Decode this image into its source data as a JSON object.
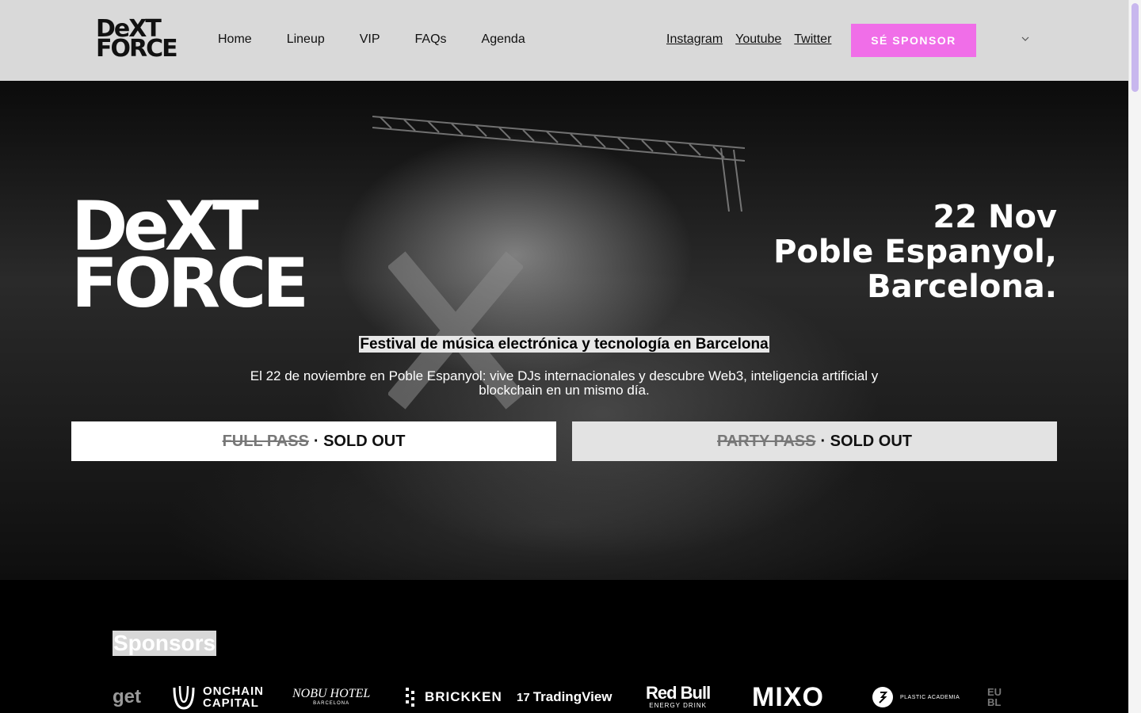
{
  "brand": {
    "logo_line1": "DeXT",
    "logo_line2": "FORCE"
  },
  "nav": {
    "items": [
      {
        "label": "Home"
      },
      {
        "label": "Lineup"
      },
      {
        "label": "VIP"
      },
      {
        "label": "FAQs"
      },
      {
        "label": "Agenda"
      }
    ]
  },
  "social": {
    "items": [
      {
        "label": "Instagram"
      },
      {
        "label": "Youtube"
      },
      {
        "label": "Twitter"
      }
    ]
  },
  "header": {
    "sponsor_button": "SÉ SPONSOR",
    "lang_icon": "chevron-down-icon"
  },
  "hero": {
    "date": "22 Nov",
    "venue_line1": "Poble Espanyol,",
    "venue_line2": "Barcelona.",
    "tagline": "Festival de música electrónica y tecnología en Barcelona",
    "description": "El 22 de noviembre en Poble Espanyol: vive DJs internacionales y descubre Web3, inteligencia artificial y blockchain en un mismo día.",
    "passes": [
      {
        "name": "FULL PASS",
        "status": "· SOLD OUT"
      },
      {
        "name": "PARTY PASS",
        "status": "· SOLD OUT"
      }
    ]
  },
  "sponsors": {
    "title": "Sponsors",
    "logos": [
      {
        "name": "get"
      },
      {
        "name": "ONCHAIN",
        "sub": "CAPITAL"
      },
      {
        "name": "NOBU HOTEL",
        "sub": "BARCELONA"
      },
      {
        "name": "BRICKKEN"
      },
      {
        "name": "TradingView"
      },
      {
        "name": "Red Bull",
        "sub": "ENERGY DRINK"
      },
      {
        "name": "MIXO"
      },
      {
        "name": "PLASTIC ACADEMIA"
      },
      {
        "name": "EU",
        "sub": "BL"
      }
    ]
  },
  "colors": {
    "accent": "#f06ee8",
    "header_bg": "#d9d9d9",
    "hero_bg": "#000000"
  }
}
